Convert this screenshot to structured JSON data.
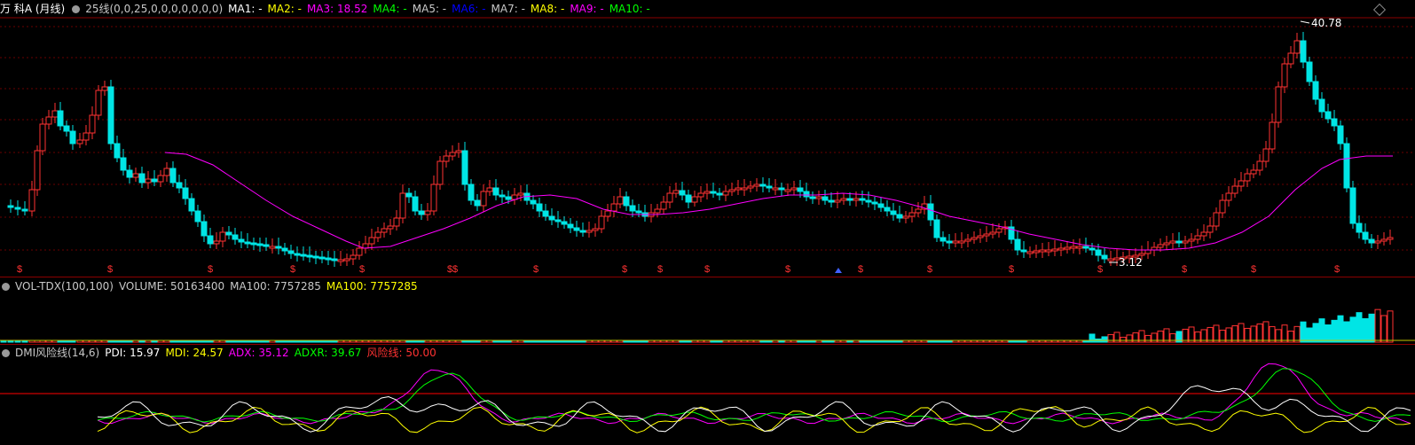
{
  "main": {
    "title": "万 科A (月线)",
    "indicator_name": "25线(0,0,25,0,0,0,0,0,0,0)",
    "ma": [
      {
        "label": "MA1: -",
        "color": "#ffffff"
      },
      {
        "label": "MA2: -",
        "color": "#ffff00"
      },
      {
        "label": "MA3: 18.52",
        "color": "#ff00ff"
      },
      {
        "label": "MA4: -",
        "color": "#00ff00"
      },
      {
        "label": "MA5: -",
        "color": "#c8c8c8"
      },
      {
        "label": "MA6: -",
        "color": "#0000ff"
      },
      {
        "label": "MA7: -",
        "color": "#c8c8c8"
      },
      {
        "label": "MA8: -",
        "color": "#ffff00"
      },
      {
        "label": "MA9: -",
        "color": "#ff00ff"
      },
      {
        "label": "MA10: -",
        "color": "#00ff00"
      }
    ],
    "high_label": "40.78",
    "low_label": "3.12",
    "marker_glyph": "$",
    "up_color": "#ff3232",
    "down_color": "#00e5e5",
    "ma_color": "#ff00ff"
  },
  "volume": {
    "name": "VOL-TDX(100,100)",
    "volume_label": "VOLUME: 50163400",
    "ma1_label": "MA100: 7757285",
    "ma2_label": "MA100: 7757285",
    "ma2_color": "#ffff00"
  },
  "dmi": {
    "name": "DMI风险线(14,6)",
    "pdi": "PDI: 15.97",
    "mdi": "MDI: 24.57",
    "adx": "ADX: 35.12",
    "adxr": "ADXR: 39.67",
    "risk": "风险线: 50.00",
    "colors": {
      "pdi": "#ffffff",
      "mdi": "#ffff00",
      "adx": "#ff00ff",
      "adxr": "#00ff00",
      "risk": "#ff0000"
    }
  }
}
